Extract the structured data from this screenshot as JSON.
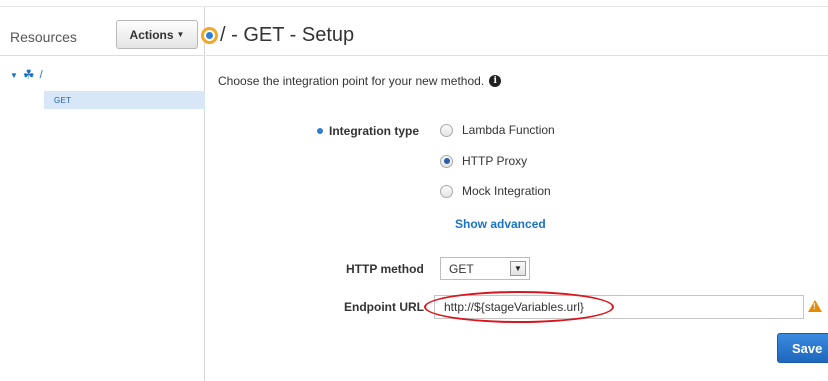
{
  "sidebar": {
    "title": "Resources",
    "actions_label": "Actions",
    "tree": {
      "root_label": "/",
      "child_label": "GET"
    }
  },
  "header": {
    "title": "/ - GET - Setup"
  },
  "main": {
    "prompt": "Choose the integration point for your new method.",
    "integration_type_label": "Integration type",
    "integration_options": [
      {
        "label": "Lambda Function",
        "selected": false
      },
      {
        "label": "HTTP Proxy",
        "selected": true
      },
      {
        "label": "Mock Integration",
        "selected": false
      }
    ],
    "show_advanced": "Show advanced",
    "http_method_label": "HTTP method",
    "http_method_value": "GET",
    "endpoint_label": "Endpoint URL",
    "endpoint_value": "http://${stageVariables.url}",
    "save_label": "Save"
  },
  "colors": {
    "accent_blue": "#2e7fd1",
    "annotation_red": "#d9151d",
    "warning_orange": "#e88b00"
  }
}
